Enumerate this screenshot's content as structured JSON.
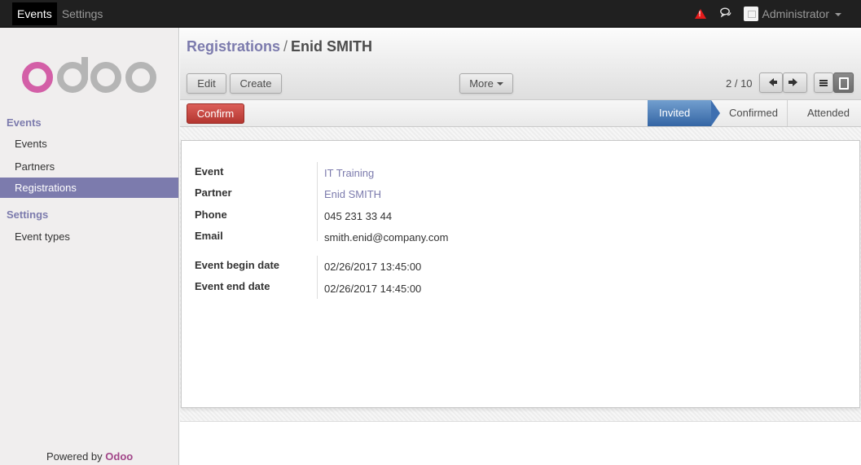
{
  "topbar": {
    "menu": [
      "Events",
      "Settings"
    ],
    "user": "Administrator"
  },
  "sidebar": {
    "logo_text": "odoo",
    "sections": [
      {
        "title": "Events",
        "items": [
          "Events",
          "Partners",
          "Registrations"
        ]
      },
      {
        "title": "Settings",
        "items": [
          "Event types"
        ]
      }
    ],
    "active_item": "Registrations",
    "powered_by": "Powered by",
    "powered_brand": "Odoo"
  },
  "header": {
    "breadcrumb_parent": "Registrations",
    "breadcrumb_sep": "/",
    "breadcrumb_current": "Enid SMITH",
    "edit_label": "Edit",
    "create_label": "Create",
    "more_label": "More",
    "pager": "2 / 10"
  },
  "statusbar": {
    "confirm_label": "Confirm",
    "stages": [
      "Invited",
      "Confirmed",
      "Attended"
    ],
    "active_stage": "Invited"
  },
  "form": {
    "fields": [
      {
        "label": "Event",
        "value": "IT Training"
      },
      {
        "label": "Partner",
        "value": "Enid SMITH"
      },
      {
        "label": "Phone",
        "value": "045 231 33 44"
      },
      {
        "label": "Email",
        "value": "smith.enid@company.com"
      },
      {
        "label": "Event begin date",
        "value": "02/26/2017 13:45:00"
      },
      {
        "label": "Event end date",
        "value": "02/26/2017 14:45:00"
      }
    ]
  },
  "colors": {
    "brand_purple": "#7c7bad",
    "odoo_pink": "#a24689",
    "confirm_red": "#c0392b",
    "stage_blue": "#3465a4",
    "topbar": "#202020"
  }
}
